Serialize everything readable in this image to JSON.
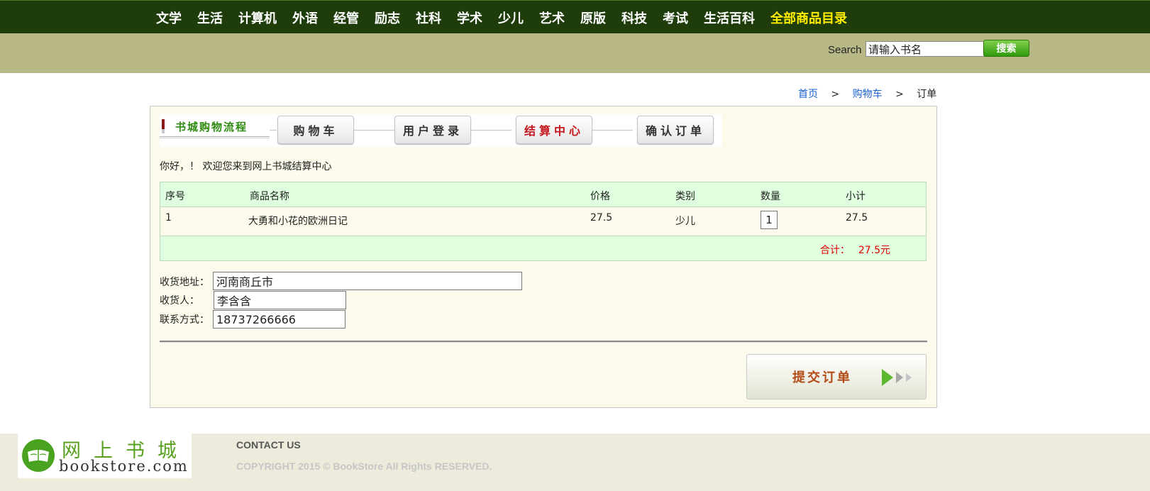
{
  "nav": {
    "items": [
      "文学",
      "生活",
      "计算机",
      "外语",
      "经管",
      "励志",
      "社科",
      "学术",
      "少儿",
      "艺术",
      "原版",
      "科技",
      "考试",
      "生活百科"
    ],
    "highlight": "全部商品目录",
    "highlight_color": "#ffee00"
  },
  "search": {
    "label": "Search",
    "value": "请输入书名",
    "button": "搜索"
  },
  "breadcrumb": {
    "home": "首页",
    "cart": "购物车",
    "current": "订单",
    "sep": ">"
  },
  "flow": {
    "title": "书城购物流程",
    "steps": [
      "购物车",
      "用户登录",
      "结算中心",
      "确认订单"
    ],
    "active_step": "结算中心"
  },
  "welcome": "你好，！ 欢迎您来到网上书城结算中心",
  "table": {
    "headers": [
      "序号",
      "商品名称",
      "价格",
      "类别",
      "数量",
      "小计"
    ],
    "rows": [
      {
        "index": "1",
        "name": "大勇和小花的欧洲日记",
        "price": "27.5",
        "category": "少儿",
        "qty": "1",
        "subtotal": "27.5"
      }
    ],
    "total_label": "合计：",
    "total_value": "27.5元"
  },
  "form": {
    "address_label": "收货地址：",
    "address_value": "河南商丘市",
    "receiver_label": "收货人：",
    "receiver_value": "李含含",
    "phone_label": "联系方式：",
    "phone_value": "18737266666"
  },
  "submit": {
    "label": "提交订单"
  },
  "footer": {
    "logo_cn": "网上书城",
    "logo_en": "bookstore.com",
    "contact": "CONTACT US",
    "copyright": "COPYRIGHT 2015 © BookStore All Rights RESERVED."
  }
}
